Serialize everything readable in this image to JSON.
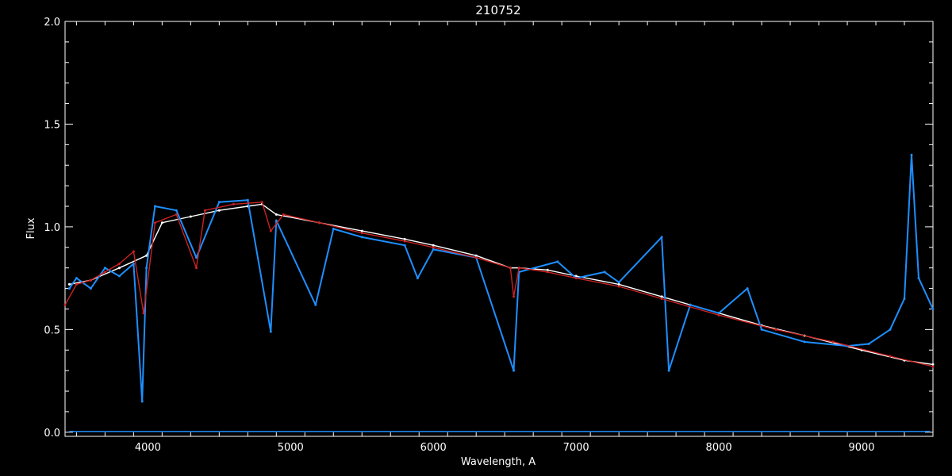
{
  "chart_data": {
    "type": "line",
    "title": "210752",
    "xlabel": "Wavelength, A",
    "ylabel": "Flux",
    "xlim": [
      3420,
      9500
    ],
    "ylim": [
      -0.02,
      2.0
    ],
    "x_ticks": [
      4000,
      5000,
      6000,
      7000,
      8000,
      9000
    ],
    "x_tick_labels": [
      "4000",
      "5000",
      "6000",
      "7000",
      "8000",
      "9000"
    ],
    "y_ticks": [
      0.0,
      0.5,
      1.0,
      1.5,
      2.0
    ],
    "y_tick_labels": [
      "0.0",
      "0.5",
      "1.0",
      "1.5",
      "2.0"
    ],
    "grid": false,
    "series": [
      {
        "color": "#ffffff",
        "x": [
          3450,
          3600,
          3800,
          3990,
          4100,
          4300,
          4500,
          4700,
          4800,
          4900,
          5200,
          5500,
          5800,
          6000,
          6300,
          6540,
          6600,
          6800,
          7000,
          7300,
          7600,
          7800,
          8000,
          8300,
          8600,
          9000,
          9300,
          9500
        ],
        "y": [
          0.72,
          0.74,
          0.8,
          0.86,
          1.02,
          1.05,
          1.08,
          1.1,
          1.11,
          1.06,
          1.02,
          0.98,
          0.94,
          0.91,
          0.86,
          0.8,
          0.8,
          0.79,
          0.76,
          0.72,
          0.66,
          0.62,
          0.58,
          0.52,
          0.47,
          0.4,
          0.35,
          0.33
        ]
      },
      {
        "color": "#1e8fff",
        "x": [
          3450,
          3500,
          3600,
          3700,
          3800,
          3900,
          3960,
          3990,
          4050,
          4200,
          4340,
          4500,
          4700,
          4861,
          4900,
          5175,
          5300,
          5500,
          5800,
          5890,
          6000,
          6300,
          6563,
          6600,
          6870,
          7000,
          7200,
          7300,
          7600,
          7650,
          7800,
          8000,
          8200,
          8300,
          8600,
          8900,
          9050,
          9200,
          9300,
          9350,
          9400,
          9500
        ],
        "y": [
          0.7,
          0.75,
          0.7,
          0.8,
          0.76,
          0.82,
          0.15,
          0.8,
          1.1,
          1.08,
          0.85,
          1.12,
          1.13,
          0.49,
          1.03,
          0.62,
          0.99,
          0.95,
          0.91,
          0.75,
          0.89,
          0.85,
          0.3,
          0.78,
          0.83,
          0.75,
          0.78,
          0.73,
          0.95,
          0.3,
          0.62,
          0.58,
          0.7,
          0.5,
          0.44,
          0.42,
          0.43,
          0.5,
          0.65,
          1.35,
          0.75,
          0.6
        ]
      },
      {
        "color": "#cc2222",
        "x": [
          3420,
          3500,
          3600,
          3700,
          3800,
          3900,
          3970,
          4050,
          4200,
          4340,
          4400,
          4600,
          4800,
          4861,
          4950,
          5200,
          5500,
          5800,
          6000,
          6300,
          6540,
          6563,
          6600,
          6800,
          7000,
          7300,
          7600,
          8000,
          8400,
          8800,
          9200,
          9500
        ],
        "y": [
          0.62,
          0.72,
          0.74,
          0.78,
          0.82,
          0.88,
          0.58,
          1.02,
          1.06,
          0.8,
          1.08,
          1.11,
          1.12,
          0.98,
          1.06,
          1.02,
          0.97,
          0.93,
          0.9,
          0.85,
          0.8,
          0.66,
          0.8,
          0.78,
          0.75,
          0.71,
          0.65,
          0.57,
          0.5,
          0.44,
          0.37,
          0.32
        ]
      }
    ]
  }
}
